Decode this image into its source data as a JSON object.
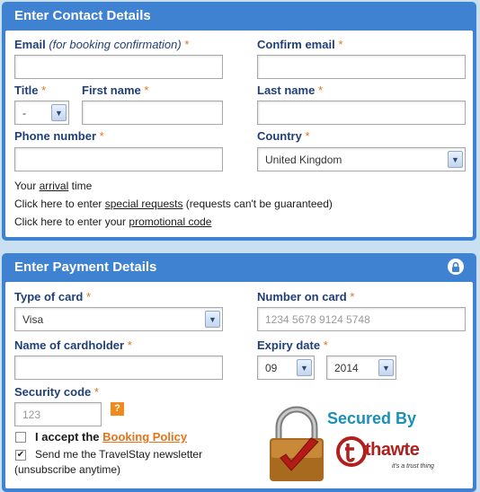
{
  "contact": {
    "header": "Enter Contact Details",
    "email_label": "Email",
    "email_note": "(for booking confirmation)",
    "confirm_email_label": "Confirm email",
    "title_label": "Title",
    "title_value": "-",
    "first_name_label": "First name",
    "last_name_label": "Last name",
    "phone_label": "Phone number",
    "country_label": "Country",
    "country_value": "United Kingdom",
    "arrival_prefix": "Your",
    "arrival_link": "arrival",
    "arrival_suffix": "time",
    "special_prefix": "Click here to enter",
    "special_link": "special requests",
    "special_suffix": "(requests can't be guaranteed)",
    "promo_prefix": "Click here to enter your",
    "promo_link": "promotional code",
    "required_mark": "*"
  },
  "payment": {
    "header": "Enter Payment Details",
    "card_type_label": "Type of card",
    "card_type_value": "Visa",
    "card_number_label": "Number on card",
    "card_number_placeholder": "1234 5678 9124 5748",
    "cardholder_label": "Name of cardholder",
    "expiry_label": "Expiry date",
    "expiry_month": "09",
    "expiry_year": "2014",
    "security_label": "Security code",
    "security_placeholder": "123",
    "help_icon_text": "?",
    "accept_prefix": "I accept the",
    "accept_link": "Booking Policy",
    "accept_checked": false,
    "newsletter_text": "Send me the TravelStay newsletter",
    "newsletter_sub": "(unsubscribe anytime)",
    "newsletter_checked": true
  },
  "badge": {
    "secured_text": "Secured By",
    "brand": "thawte",
    "tagline": "it's a trust thing"
  },
  "colors": {
    "panel_blue": "#3f82d2",
    "required_orange": "#e3731a",
    "label_navy": "#213f77",
    "badge_red": "#b0201e"
  }
}
